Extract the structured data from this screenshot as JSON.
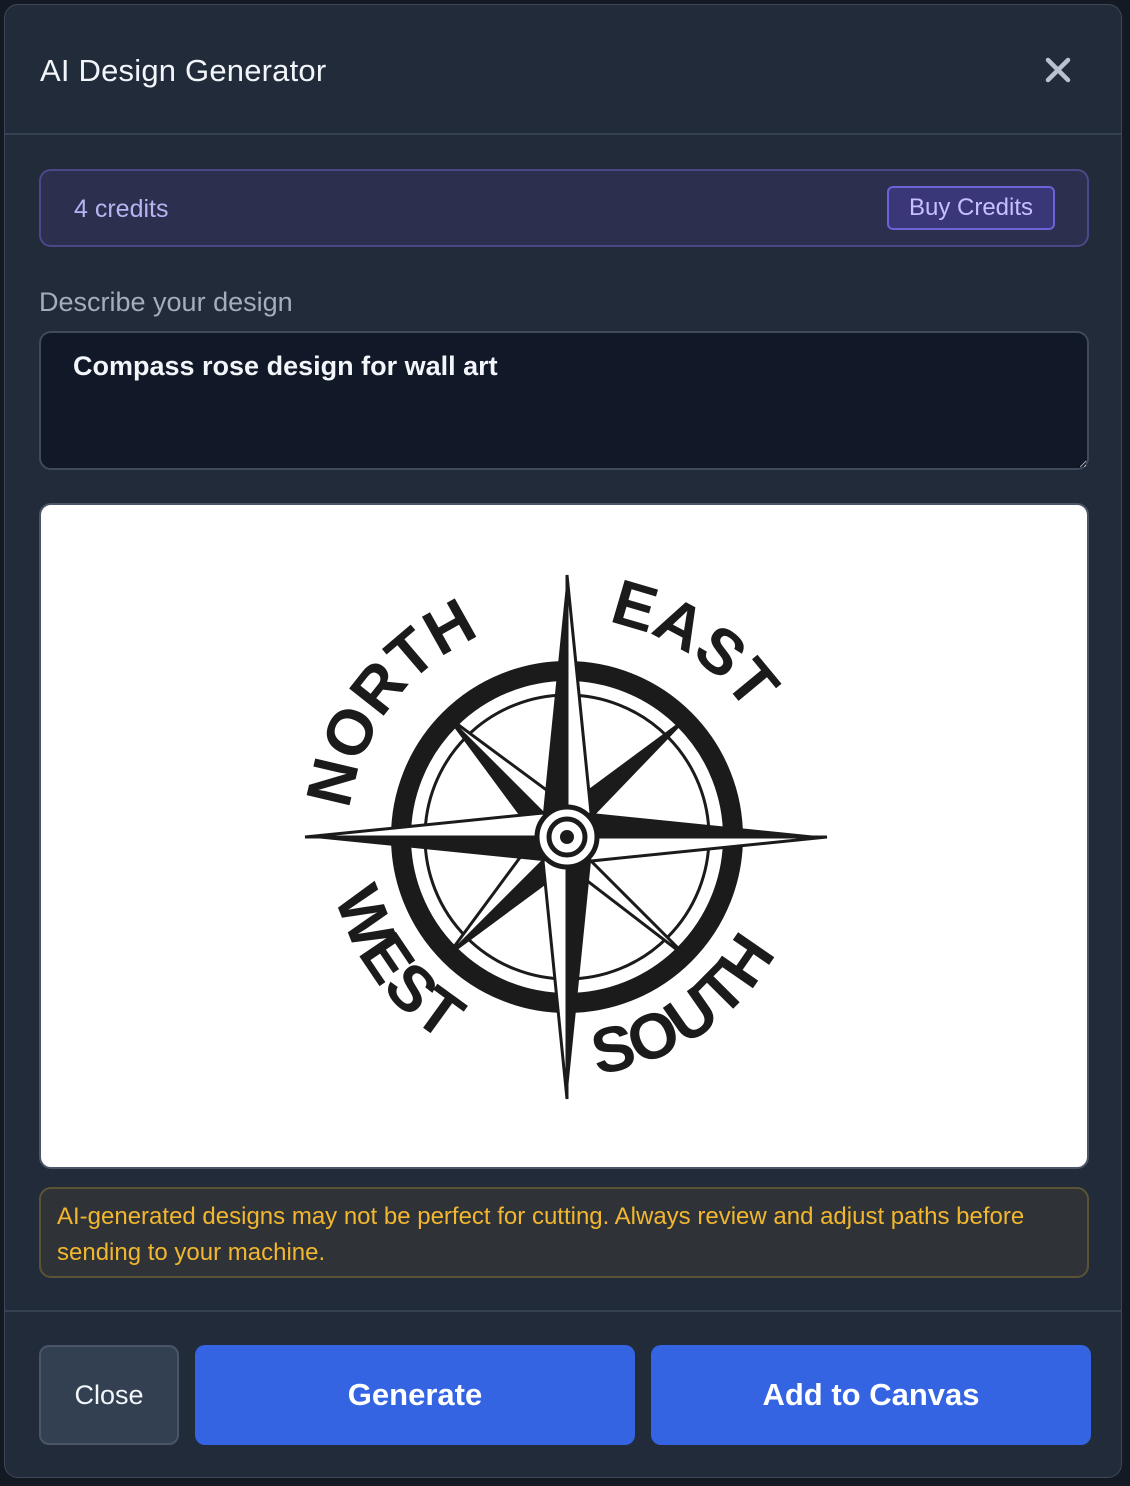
{
  "dialog": {
    "title": "AI Design Generator"
  },
  "credits": {
    "text": "4 credits",
    "buy_label": "Buy Credits"
  },
  "prompt": {
    "label": "Describe your design",
    "value": "Compass rose design for wall art"
  },
  "preview": {
    "words": {
      "north": "NORTH",
      "east": "EAST",
      "south": "SOUTH",
      "west": "WEST"
    }
  },
  "warning": {
    "text": "AI-generated designs may not be perfect for cutting. Always review and adjust paths before sending to your machine."
  },
  "footer": {
    "close_label": "Close",
    "generate_label": "Generate",
    "add_label": "Add to Canvas"
  },
  "colors": {
    "accent": "#3564e3",
    "credit_purple": "#b6b4f2",
    "warning_amber": "#f2b72f"
  },
  "icons": {
    "close": "close-icon",
    "design": "compass-rose-icon"
  }
}
